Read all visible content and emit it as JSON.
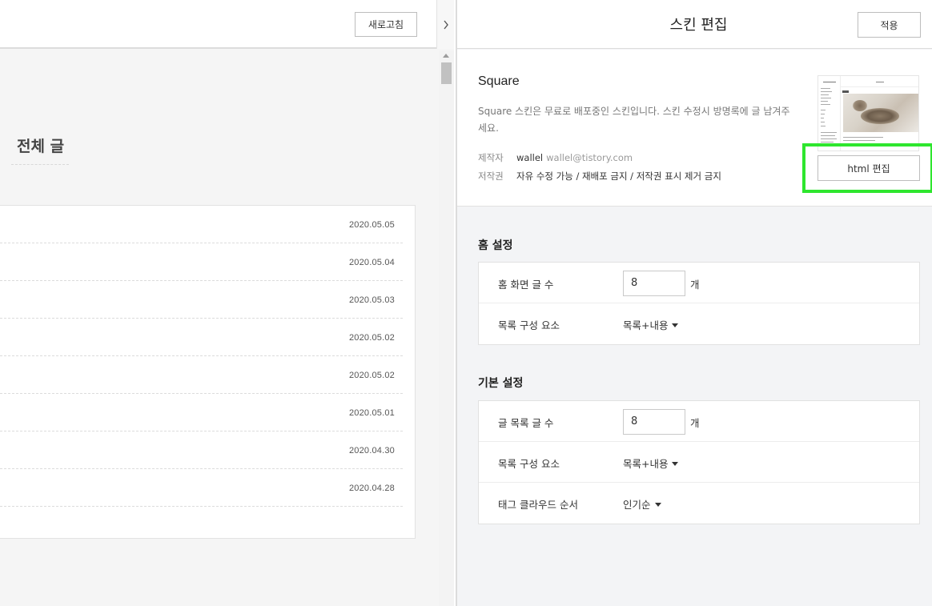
{
  "preview": {
    "refresh_label": "새로고침",
    "collapse_icon": "chevron-right-icon",
    "section_title": "전체 글",
    "posts": [
      {
        "date": "2020.05.05"
      },
      {
        "date": "2020.05.04"
      },
      {
        "date": "2020.05.03"
      },
      {
        "date": "2020.05.02"
      },
      {
        "date": "2020.05.02"
      },
      {
        "date": "2020.05.01"
      },
      {
        "date": "2020.04.30"
      },
      {
        "date": "2020.04.28"
      }
    ]
  },
  "editor": {
    "title": "스킨 편집",
    "apply_label": "적용",
    "skin": {
      "name": "Square",
      "description": "Square 스킨은 무료로 배포중인 스킨입니다. 스킨 수정시 방명록에 글 남겨주세요.",
      "maker_label": "제작자",
      "maker_name": "wallel",
      "maker_email": "wallel@tistory.com",
      "license_label": "저작권",
      "license_text": "자유 수정 가능 / 재배포 금지 / 저작권 표시 제거 금지",
      "html_edit_label": "html 편집"
    },
    "highlight_color": "#2ee62e",
    "home_settings": {
      "title": "홈 설정",
      "post_count_label": "홈 화면 글 수",
      "post_count_value": "8",
      "post_count_unit": "개",
      "list_element_label": "목록 구성 요소",
      "list_element_value": "목록+내용"
    },
    "basic_settings": {
      "title": "기본 설정",
      "post_count_label": "글 목록 글 수",
      "post_count_value": "8",
      "post_count_unit": "개",
      "list_element_label": "목록 구성 요소",
      "list_element_value": "목록+내용",
      "tag_cloud_label": "태그 클라우드 순서",
      "tag_cloud_value": "인기순"
    }
  }
}
